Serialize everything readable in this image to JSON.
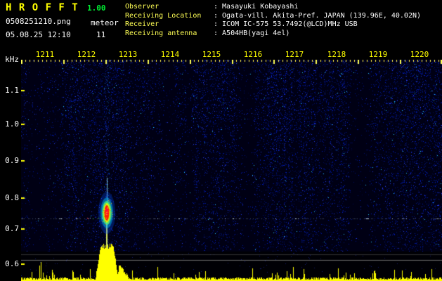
{
  "header": {
    "app_name": "H R O F F T",
    "version": "1.00",
    "filename": "0508251210.png",
    "mode_label": "meteor",
    "timestamp": "05.08.25 12:10",
    "echo_count": "11",
    "info_rows": [
      {
        "label": "Observer",
        "value": ": Masayuki Kobayashi"
      },
      {
        "label": "Receiving Location",
        "value": ": Ogata-vill. Akita-Pref. JAPAN (139.96E, 40.02N)"
      },
      {
        "label": "Receiver",
        "value": ": ICOM IC-575 53.7492(@LCD)MHz USB"
      },
      {
        "label": "Receiving antenna",
        "value": ": A504HB(yagi 4el)"
      }
    ]
  },
  "spectrogram": {
    "freq_axis": [
      "kHz",
      "1.1",
      "1.0",
      "0.9",
      "0.8",
      "0.7",
      "0.6"
    ],
    "time_ticks": [
      "1211",
      "1212",
      "1213",
      "1214",
      "1215",
      "1216",
      "1217",
      "1218",
      "1219",
      "1220"
    ]
  },
  "colors": {
    "app_name": "#ffff00",
    "version": "#00ee33",
    "info_label": "#ffff55",
    "info_value": "#ffffff",
    "time_tick_label": "#ffff00",
    "freq_tick_label": "#ffffff",
    "axis_tick": "#ffff00",
    "noise_base": "#000014",
    "level_bar": "#ffff00",
    "echo_core": "#ff2000",
    "carrier_dots": "#8c9ab4"
  },
  "chart_data": {
    "type": "heatmap",
    "title": "HROFFT radio meteor echo spectrogram 05.08.25 12:10-12:20",
    "x_axis": {
      "ticks": [
        "1211",
        "1212",
        "1213",
        "1214",
        "1215",
        "1216",
        "1217",
        "1218",
        "1219",
        "1220"
      ],
      "start": "12:10",
      "end": "12:20",
      "units": "hhmm"
    },
    "y_axis": {
      "label": "kHz",
      "ticks": [
        1.1,
        1.0,
        0.9,
        0.8,
        0.7,
        0.6
      ],
      "range_khz": [
        0.6,
        1.19
      ]
    },
    "carrier_line_khz": 0.73,
    "events": [
      {
        "kind": "meteor-echo",
        "time": "~12:12",
        "time_frac": 0.204,
        "center_freq_khz": 0.745,
        "intensity": "saturated overdense echo: red core, yellow-green halo, cyan-blue glow, full-height ionization column"
      }
    ],
    "level_plot": {
      "position": "bottom-strip",
      "burst_time_frac": 0.204,
      "burst_rel_height": 0.9,
      "background_rel_height": 0.08
    },
    "legend": "intensity colormap black-blue-cyan-green-yellow-red",
    "grid": "off"
  }
}
